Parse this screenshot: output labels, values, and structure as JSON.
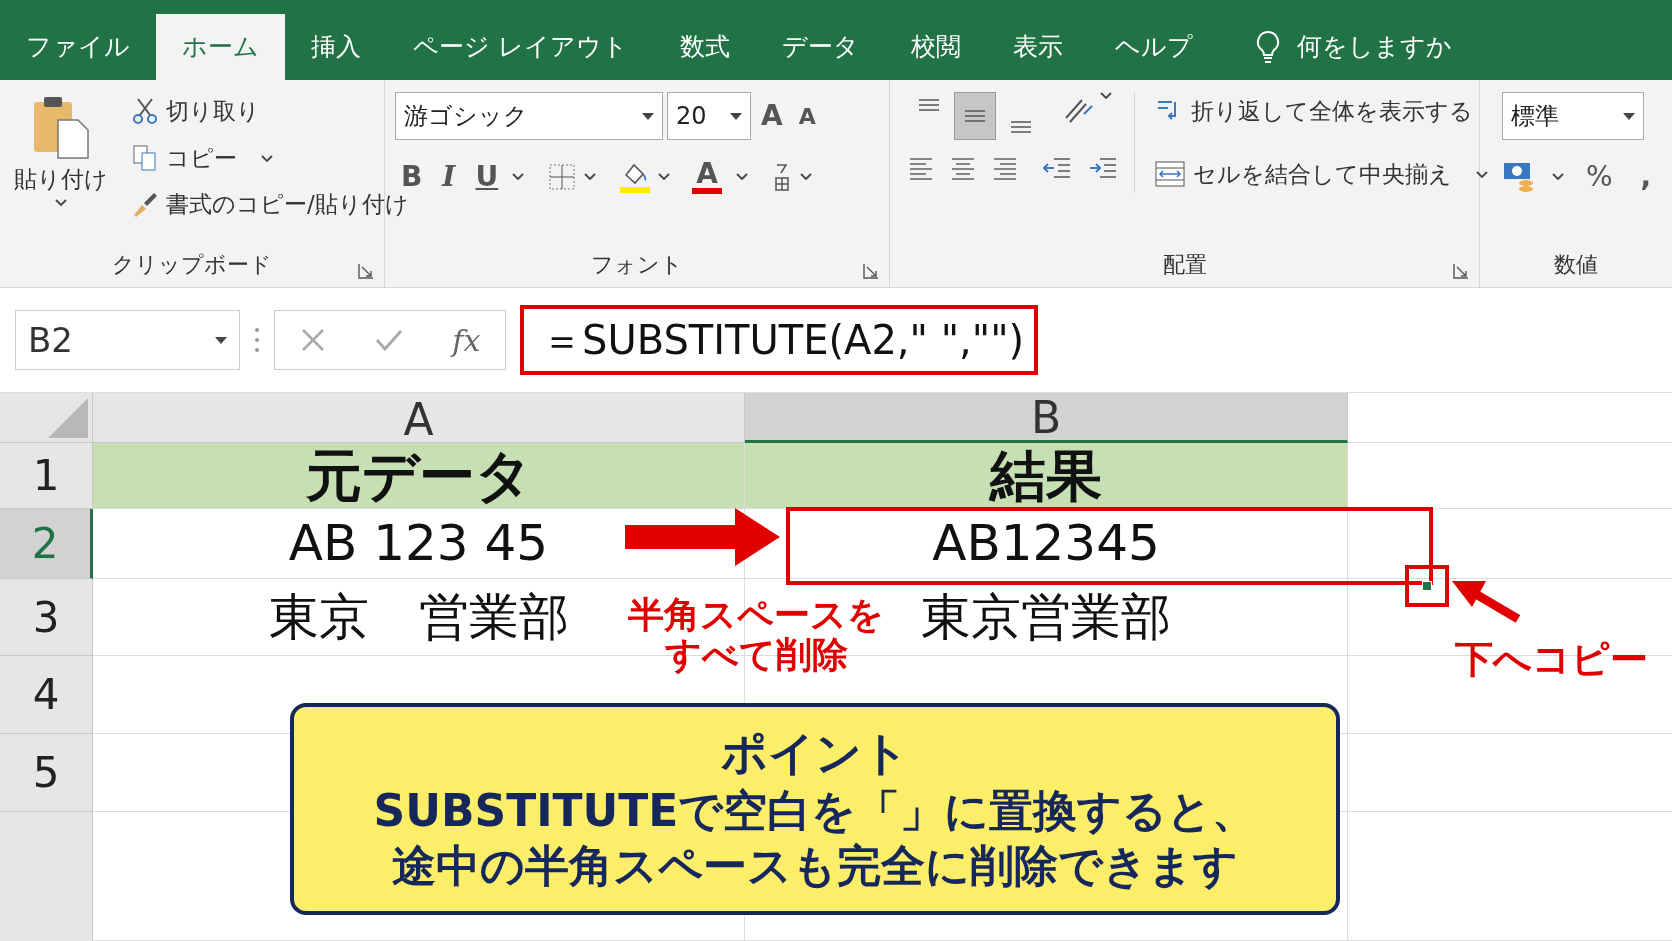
{
  "tabs": [
    {
      "label": "ファイル",
      "selected": false
    },
    {
      "label": "ホーム",
      "selected": true
    },
    {
      "label": "挿入",
      "selected": false
    },
    {
      "label": "ページ レイアウト",
      "selected": false
    },
    {
      "label": "数式",
      "selected": false
    },
    {
      "label": "データ",
      "selected": false
    },
    {
      "label": "校閲",
      "selected": false
    },
    {
      "label": "表示",
      "selected": false
    },
    {
      "label": "ヘルプ",
      "selected": false
    }
  ],
  "tell_me": "何をしますか",
  "ribbon": {
    "clipboard": {
      "label": "クリップボード",
      "paste": "貼り付け",
      "cut": "切り取り",
      "copy": "コピー",
      "format_painter": "書式のコピー/貼り付け"
    },
    "font": {
      "label": "フォント",
      "font_name": "游ゴシック",
      "font_size": "20",
      "grow": "A",
      "shrink": "A",
      "bold": "B",
      "italic": "I",
      "underline": "U",
      "font_color": "A"
    },
    "alignment": {
      "label": "配置",
      "vertical": [
        {
          "selected": false
        },
        {
          "selected": true
        },
        {
          "selected": false
        }
      ],
      "wrap_text": "折り返して全体を表示する",
      "merge": "セルを結合して中央揃え"
    },
    "number": {
      "label": "数値",
      "format": "標準",
      "percent": "%",
      "comma": ","
    }
  },
  "formula_bar": {
    "name_box": "B2",
    "fx": "fx",
    "formula": "＝SUBSTITUTE(A2,\" \",\"\")",
    "highlighted": true
  },
  "grid": {
    "columns": [
      {
        "label": "A",
        "selected": false
      },
      {
        "label": "B",
        "selected": true
      }
    ],
    "rows": [
      {
        "number": "1",
        "selected": false,
        "kind": "header",
        "cells": [
          "元データ",
          "結果"
        ]
      },
      {
        "number": "2",
        "selected": true,
        "kind": "data",
        "cells": [
          "AB 123 45",
          "AB12345"
        ]
      },
      {
        "number": "3",
        "selected": false,
        "kind": "data",
        "cells": [
          "東京　営業部",
          "東京営業部"
        ]
      },
      {
        "number": "4",
        "selected": false,
        "kind": "data",
        "cells": [
          "",
          ""
        ]
      },
      {
        "number": "5",
        "selected": false,
        "kind": "data",
        "cells": [
          "",
          ""
        ]
      }
    ]
  },
  "annotations": {
    "arrow_label": [
      "半角スペースを",
      "すべて削除"
    ],
    "copy_label": "下へコピー"
  },
  "callout": {
    "title": "ポイント",
    "lines": [
      "SUBSTITUTEで空白を「」に置換すると、",
      "途中の半角スペースも完全に削除できます"
    ]
  }
}
